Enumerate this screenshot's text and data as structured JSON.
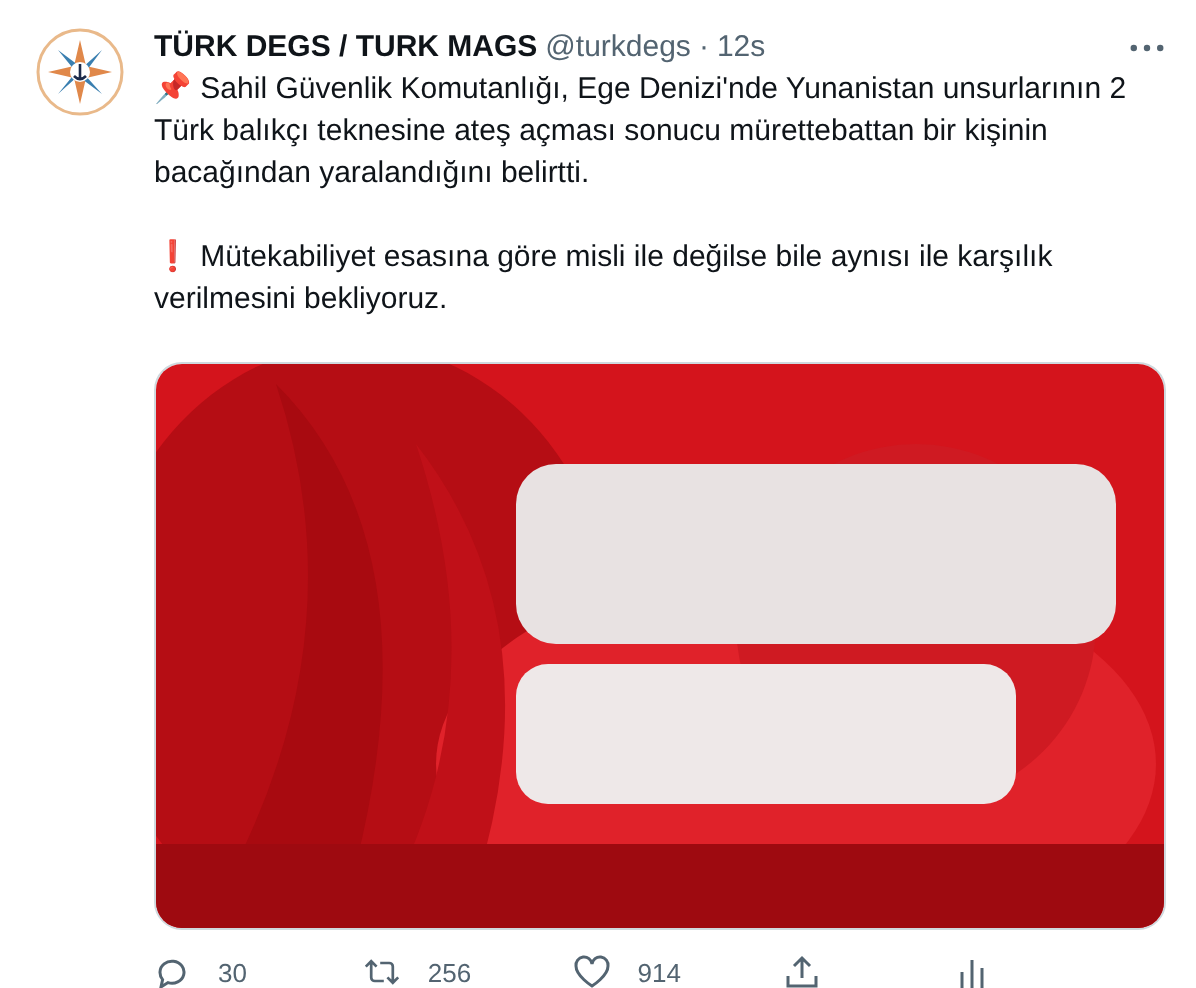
{
  "tweet": {
    "display_name": "TÜRK DEGS / TURK MAGS",
    "handle": "@turkdegs",
    "separator": "·",
    "time": "12s",
    "paragraphs": [
      {
        "text": "📌 Sahil Güvenlik Komutanlığı, Ege Denizi'nde Yunanistan unsurlarının 2 Türk balıkçı teknesine ateş açması sonucu mürettebattan bir kişinin bacağından yaralandığını belirtti."
      },
      {
        "text": "❗ Mütekabiliyet esasına göre misli ile değilse bile aynısı ile karşılık verilmesini bekliyoruz."
      }
    ],
    "actions": [
      {
        "kind": "reply",
        "count": "30"
      },
      {
        "kind": "retweet",
        "count": "256"
      },
      {
        "kind": "like",
        "count": "914"
      },
      {
        "kind": "share"
      },
      {
        "kind": "analytics"
      }
    ]
  }
}
